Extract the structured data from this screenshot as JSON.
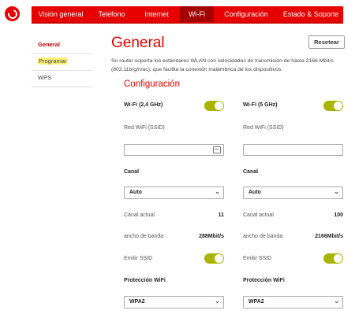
{
  "nav": {
    "tabs": [
      {
        "label": "Visión general"
      },
      {
        "label": "Teléfono"
      },
      {
        "label": "Internet"
      },
      {
        "label": "Wi-Fi"
      },
      {
        "label": "Configuración"
      },
      {
        "label": "Estado & Soporte"
      }
    ],
    "active_tab": "Wi-Fi"
  },
  "sidebar": {
    "items": [
      {
        "label": "General"
      },
      {
        "label": "Programar"
      },
      {
        "label": "WPS"
      }
    ]
  },
  "page": {
    "title": "General",
    "reset_label": "Resetear",
    "description": "Su router soporta los estándares WLAN con velocidades de transmisión de hasta 2166 Mbit/s (802.11b/g/n/ac), que facilita la conexión inalámbrica de los dispositivos.",
    "section_title": "Configuración"
  },
  "bands": [
    {
      "wifi_label": "Wi-Fi (2,4 GHz)",
      "wifi_on": true,
      "ssid_label": "Red WiFi (SSID)",
      "ssid_value": "",
      "channel_label": "Canal",
      "channel_value": "Auto",
      "current_channel_label": "Canal actual",
      "current_channel_value": "11",
      "bandwidth_label": "ancho de banda",
      "bandwidth_value": "288Mbit/s",
      "broadcast_label": "Emitir SSID",
      "broadcast_on": true,
      "protection_label": "Protección WiFi",
      "protection_value": "WPA2"
    },
    {
      "wifi_label": "Wi-Fi (5 GHz)",
      "wifi_on": true,
      "ssid_label": "Red WiFi (SSID)",
      "ssid_value": "",
      "channel_label": "Canal",
      "channel_value": "Auto",
      "current_channel_label": "Canal actual",
      "current_channel_value": "100",
      "bandwidth_label": "ancho de banda",
      "bandwidth_value": "2166Mbit/s",
      "broadcast_label": "Emitir SSID",
      "broadcast_on": true,
      "protection_label": "Protección WiFi",
      "protection_value": "WPA2"
    }
  ],
  "colors": {
    "brand_red": "#e60000",
    "toggle_on": "#a8b400",
    "highlight": "#fff27a"
  }
}
